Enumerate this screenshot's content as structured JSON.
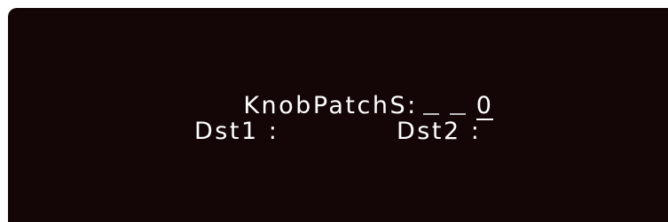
{
  "display": {
    "patch_label": "KnobPatchS:",
    "patch_value": "0",
    "dst1_label": "Dst1 :",
    "dst2_label": "Dst2 :"
  }
}
